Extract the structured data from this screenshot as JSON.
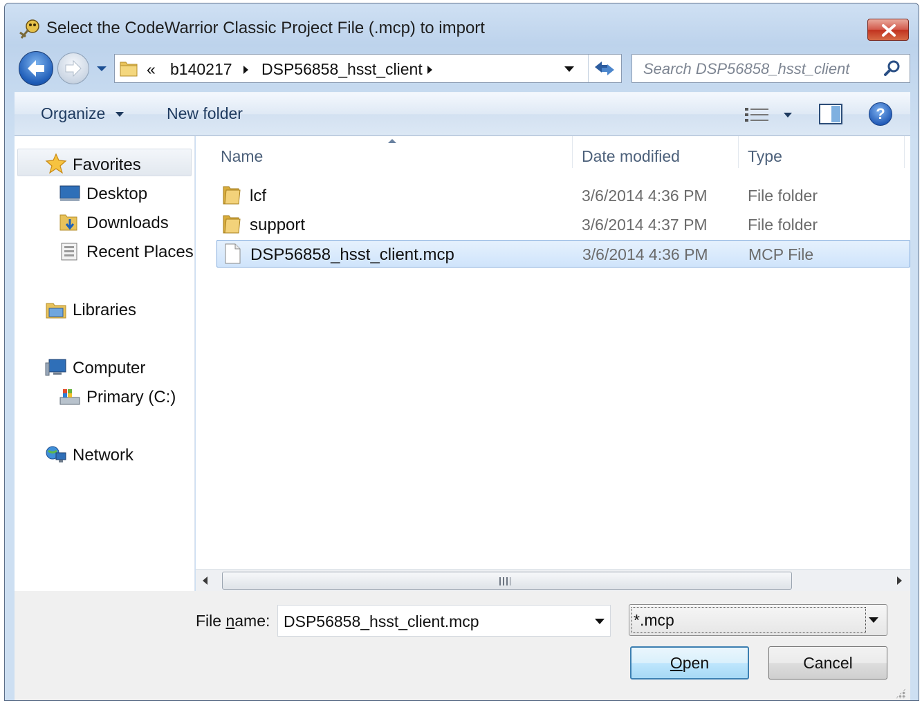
{
  "window": {
    "title": "Select the CodeWarrior Classic Project File (.mcp) to import",
    "close_icon": "close-icon"
  },
  "navigation": {
    "back_icon": "back-arrow-icon",
    "forward_icon": "forward-arrow-icon",
    "breadcrumb_overflow": "«",
    "breadcrumb": [
      "b140217",
      "DSP56858_hsst_client"
    ],
    "refresh_icon": "refresh-icon",
    "search_placeholder": "Search DSP56858_hsst_client"
  },
  "toolbar": {
    "organize_label": "Organize",
    "new_folder_label": "New folder"
  },
  "sidebar": {
    "favorites_label": "Favorites",
    "favorites": [
      {
        "label": "Desktop",
        "icon": "desktop-icon"
      },
      {
        "label": "Downloads",
        "icon": "downloads-icon"
      },
      {
        "label": "Recent Places",
        "icon": "recent-places-icon"
      }
    ],
    "libraries_label": "Libraries",
    "computer_label": "Computer",
    "computer_children": [
      {
        "label": "Primary (C:)",
        "icon": "drive-icon"
      }
    ],
    "network_label": "Network"
  },
  "file_list": {
    "columns": [
      "Name",
      "Date modified",
      "Type"
    ],
    "rows": [
      {
        "name": "lcf",
        "date": "3/6/2014 4:36 PM",
        "type": "File folder",
        "icon": "folder-icon"
      },
      {
        "name": "support",
        "date": "3/6/2014 4:37 PM",
        "type": "File folder",
        "icon": "folder-icon"
      },
      {
        "name": "DSP56858_hsst_client.mcp",
        "date": "3/6/2014 4:36 PM",
        "type": "MCP File",
        "icon": "file-icon",
        "selected": true
      }
    ]
  },
  "footer": {
    "file_name_label_pre": "File ",
    "file_name_label_u": "n",
    "file_name_label_post": "ame:",
    "file_name_value": "DSP56858_hsst_client.mcp",
    "file_type_value": "*.mcp",
    "open_label_u": "O",
    "open_label_rest": "pen",
    "cancel_label": "Cancel"
  },
  "colors": {
    "selection": "#cfe4fb",
    "window_frame": "#bdd3ec",
    "close_button": "#c1321f"
  }
}
